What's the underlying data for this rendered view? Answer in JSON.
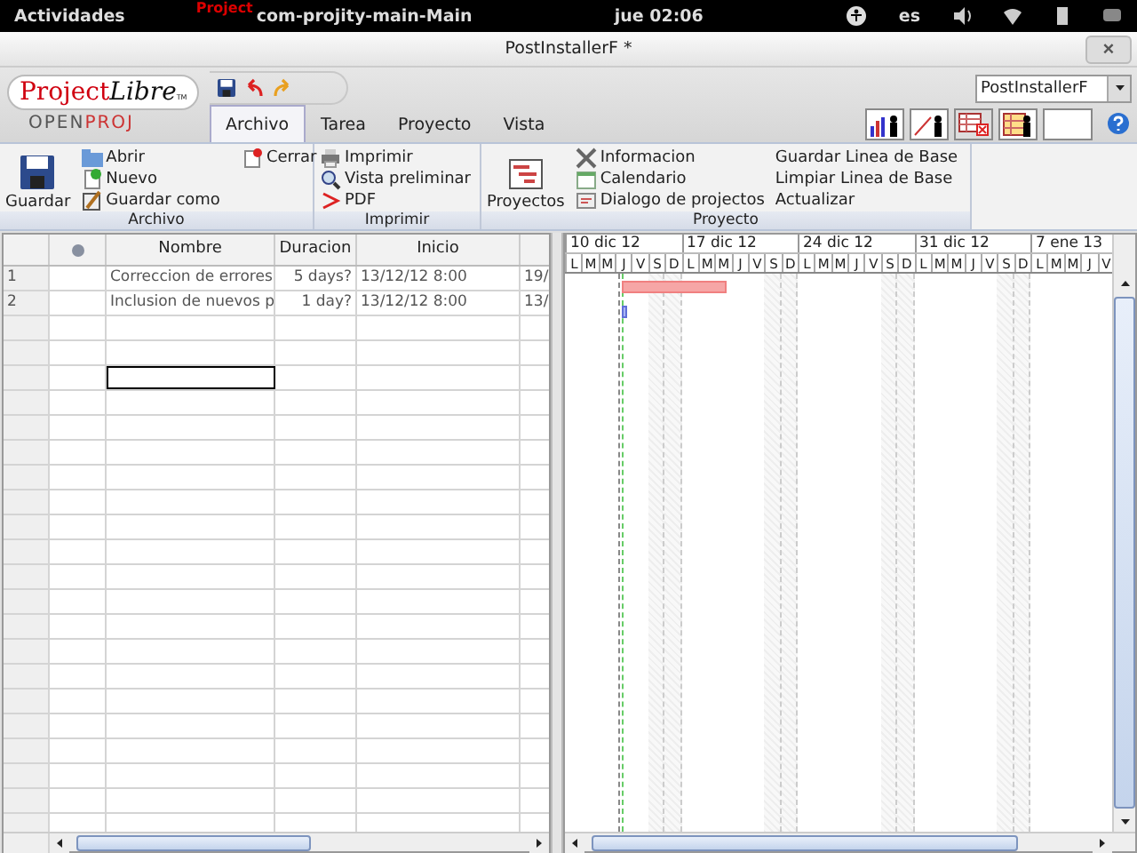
{
  "top_bar": {
    "activities": "Actividades",
    "app_badge": "Project",
    "app_name": "com-projity-main-Main",
    "clock": "jue 02:06",
    "language": "es"
  },
  "window": {
    "title": "PostInstallerF *",
    "close": "×"
  },
  "logo": {
    "brand_a": "Project",
    "brand_b": "Libre",
    "tm": "TM",
    "sub_a": "OPEN",
    "sub_b": "PROJ"
  },
  "project_select": {
    "value": "PostInstallerF"
  },
  "tabs": [
    {
      "label": "Archivo",
      "selected": true
    },
    {
      "label": "Tarea",
      "selected": false
    },
    {
      "label": "Proyecto",
      "selected": false
    },
    {
      "label": "Vista",
      "selected": false
    }
  ],
  "ribbon": {
    "archivo": {
      "title": "Archivo",
      "large": "Guardar",
      "items": [
        "Abrir",
        "Nuevo",
        "Guardar como"
      ],
      "close": "Cerrar"
    },
    "imprimir": {
      "title": "Imprimir",
      "items": [
        "Imprimir",
        "Vista preliminar",
        "PDF"
      ]
    },
    "proyecto": {
      "title": "Proyecto",
      "large": "Proyectos",
      "items": [
        "Informacion",
        "Calendario",
        "Dialogo de projectos"
      ],
      "baseline": [
        "Guardar Linea de Base",
        "Limpiar Linea de Base",
        "Actualizar"
      ]
    }
  },
  "table": {
    "columns": [
      "Nombre",
      "Duracion",
      "Inicio"
    ],
    "rows": [
      {
        "number": "1",
        "name": "Correccion de errores",
        "duration": "5 days?",
        "start": "13/12/12 8:00",
        "column_6": "19/",
        "critical": true
      },
      {
        "number": "2",
        "name": "Inclusion de nuevos p",
        "duration": "1 day?",
        "start": "13/12/12 8:00",
        "column_6": "13/",
        "critical": false
      }
    ],
    "blank_rows": [
      {
        "selected": false
      },
      {
        "selected": false
      },
      {
        "selected": true
      },
      {
        "selected": false
      },
      {
        "selected": false
      },
      {
        "selected": false
      },
      {
        "selected": false
      },
      {
        "selected": false
      },
      {
        "selected": false
      },
      {
        "selected": false
      },
      {
        "selected": false
      },
      {
        "selected": false
      },
      {
        "selected": false
      },
      {
        "selected": false
      },
      {
        "selected": false
      },
      {
        "selected": false
      },
      {
        "selected": false
      },
      {
        "selected": false
      },
      {
        "selected": false
      },
      {
        "selected": false
      },
      {
        "selected": false
      }
    ]
  },
  "gantt": {
    "weeks": [
      {
        "label": "10 dic 12",
        "days": [
          "L",
          "M",
          "M",
          "J",
          "V",
          "S",
          "D"
        ]
      },
      {
        "label": "17 dic 12",
        "days": [
          "L",
          "M",
          "M",
          "J",
          "V",
          "S",
          "D"
        ]
      },
      {
        "label": "24 dic 12",
        "days": [
          "L",
          "M",
          "M",
          "J",
          "V",
          "S",
          "D"
        ]
      },
      {
        "label": "31 dic 12",
        "days": [
          "L",
          "M",
          "M",
          "J",
          "V",
          "S",
          "D"
        ]
      },
      {
        "label": "7 ene 13",
        "days": [
          "L",
          "M",
          "M",
          "J",
          "V"
        ]
      }
    ]
  }
}
